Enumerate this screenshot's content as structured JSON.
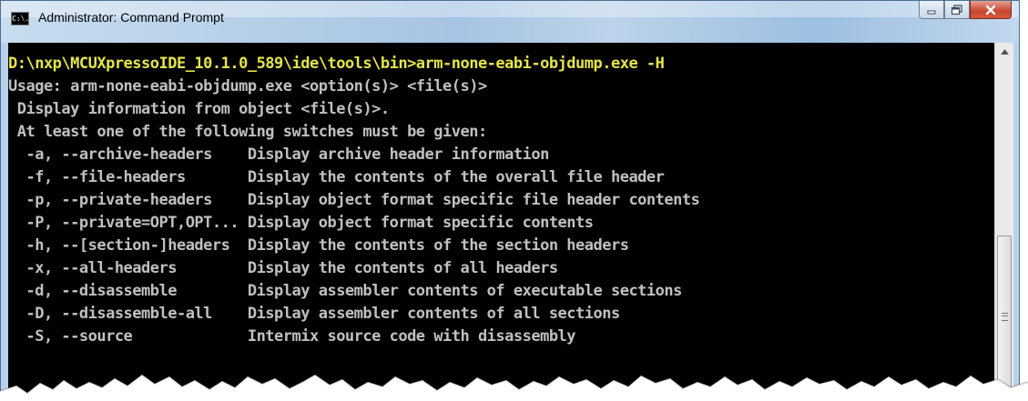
{
  "window": {
    "title": "Administrator: Command Prompt",
    "icon_text": "C:\\."
  },
  "console": {
    "lines": [
      "D:\\nxp\\MCUXpressoIDE_10.1.0_589\\ide\\tools\\bin>arm-none-eabi-objdump.exe -H",
      "Usage: arm-none-eabi-objdump.exe <option(s)> <file(s)>",
      " Display information from object <file(s)>.",
      " At least one of the following switches must be given:",
      "  -a, --archive-headers    Display archive header information",
      "  -f, --file-headers       Display the contents of the overall file header",
      "  -p, --private-headers    Display object format specific file header contents",
      "  -P, --private=OPT,OPT... Display object format specific contents",
      "  -h, --[section-]headers  Display the contents of the section headers",
      "  -x, --all-headers        Display the contents of all headers",
      "  -d, --disassemble        Display assembler contents of executable sections",
      "  -D, --disassemble-all    Display assembler contents of all sections",
      "  -S, --source             Intermix source code with disassembly"
    ],
    "colors": {
      "background": "#000000",
      "text": "#c0c0c0",
      "command": "#e5e54a"
    }
  }
}
